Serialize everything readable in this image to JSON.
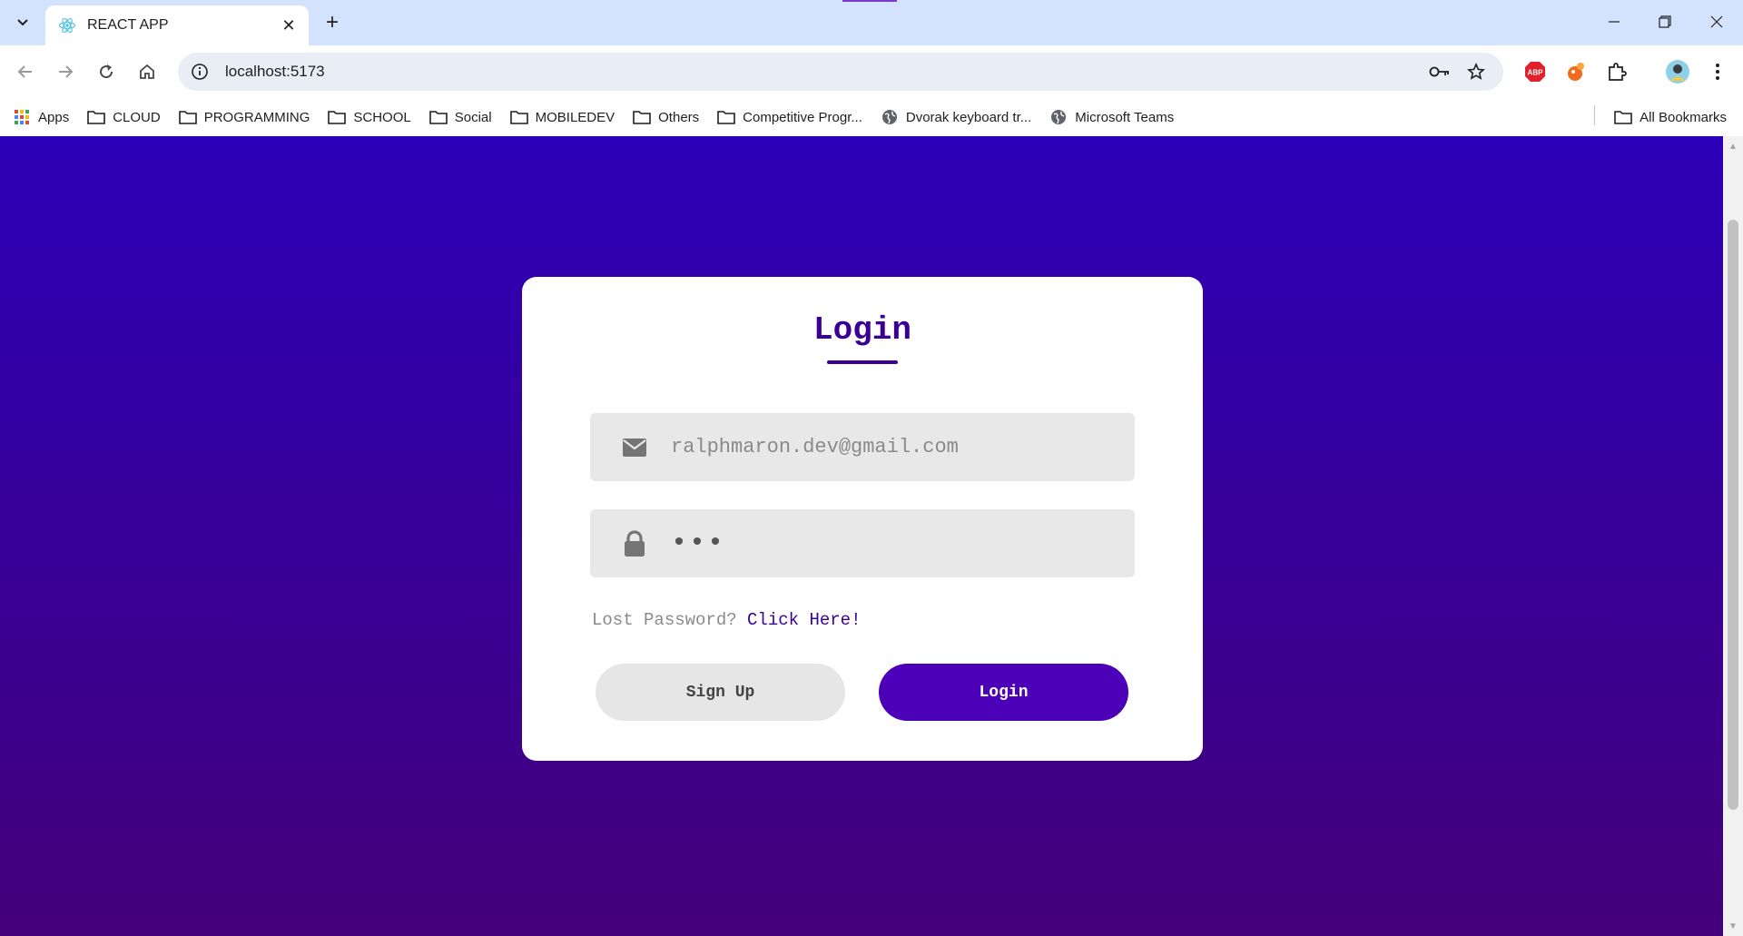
{
  "browser": {
    "tab": {
      "title": "REACT APP",
      "favicon": "react-icon"
    },
    "url": "localhost:5173",
    "bookmarks": [
      {
        "label": "Apps",
        "icon": "apps-grid-icon"
      },
      {
        "label": "CLOUD",
        "icon": "folder-icon"
      },
      {
        "label": "PROGRAMMING",
        "icon": "folder-icon"
      },
      {
        "label": "SCHOOL",
        "icon": "folder-icon"
      },
      {
        "label": "Social",
        "icon": "folder-icon"
      },
      {
        "label": "MOBILEDEV",
        "icon": "folder-icon"
      },
      {
        "label": "Others",
        "icon": "folder-icon"
      },
      {
        "label": "Competitive Progr...",
        "icon": "folder-icon"
      },
      {
        "label": "Dvorak keyboard tr...",
        "icon": "globe-icon"
      },
      {
        "label": "Microsoft Teams",
        "icon": "globe-icon"
      }
    ],
    "all_bookmarks": "All Bookmarks",
    "extensions": [
      "adblock-plus-icon",
      "extension-orange-icon",
      "puzzle-icon"
    ]
  },
  "login": {
    "title": "Login",
    "email_value": "ralphmaron.dev@gmail.com",
    "password_value": "•••",
    "lost_text": "Lost Password?",
    "lost_link": "Click Here!",
    "signup_label": "Sign Up",
    "login_label": "Login"
  },
  "colors": {
    "accent": "#3a0096",
    "login_button": "#4c00b8",
    "bg_top": "#2c00b8",
    "bg_bottom": "#44007a"
  }
}
